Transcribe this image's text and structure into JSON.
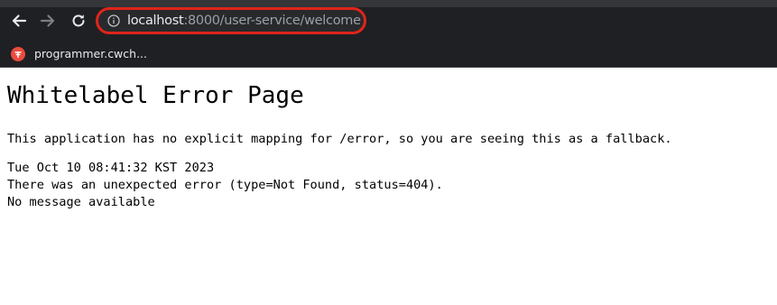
{
  "browser": {
    "address_bar": {
      "host": "localhost",
      "path": ":8000/user-service/welcome",
      "highlight_color": "#e0241b"
    },
    "icons": {
      "back": "arrow-left-icon",
      "forward": "arrow-right-icon",
      "reload": "reload-icon",
      "site_info": "info-circle-icon"
    },
    "bookmarks": [
      {
        "label": "programmer.cwch...",
        "favicon_color": "#ea4b3c"
      }
    ]
  },
  "page": {
    "title": "Whitelabel Error Page",
    "message": "This application has no explicit mapping for /error, so you are seeing this as a fallback.",
    "timestamp": "Tue Oct 10 08:41:32 KST 2023",
    "error_detail": "There was an unexpected error (type=Not Found, status=404).",
    "error_message": "No message available"
  }
}
